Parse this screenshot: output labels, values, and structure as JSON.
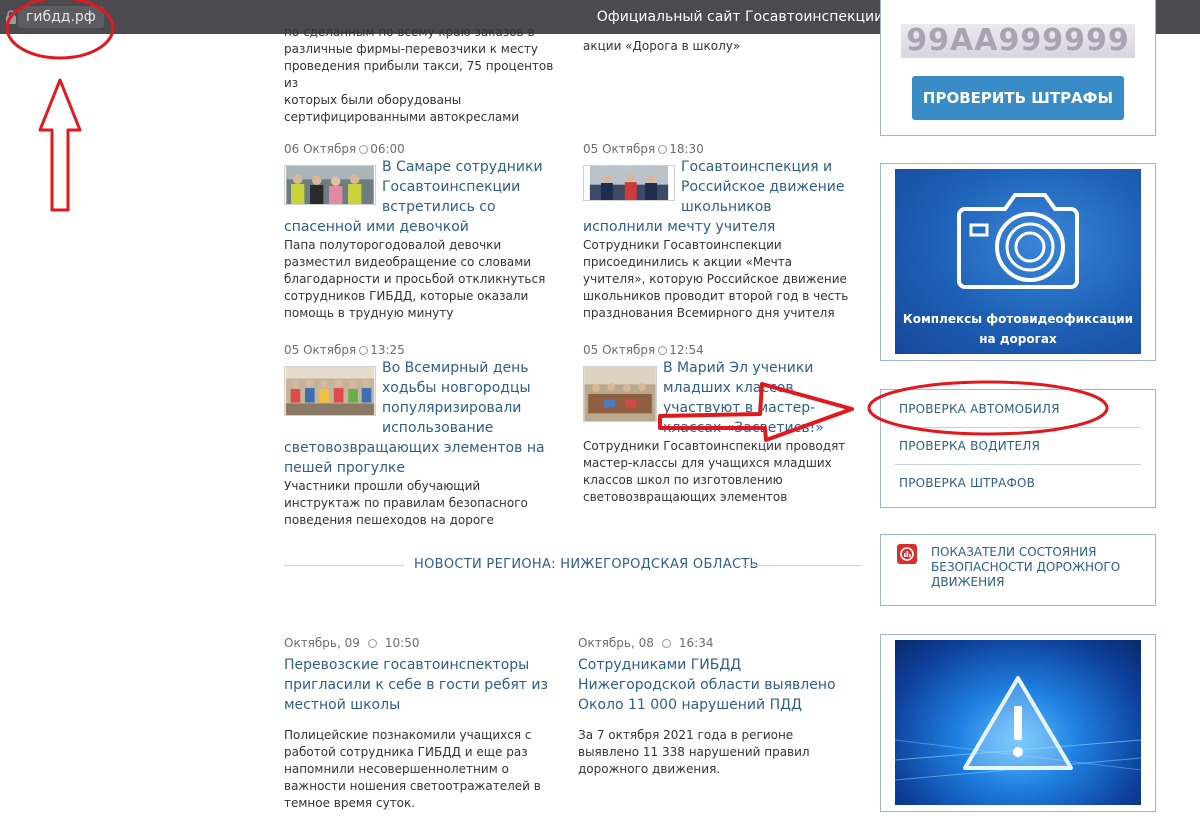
{
  "window": {
    "domain": "гибдд.рф",
    "title": "Официальный сайт Госавтоинспекции"
  },
  "top_fragments": {
    "left_lines": [
      "по сделанным по всему краю заказов в",
      "различные фирмы-перевозчики к месту",
      "проведения прибыли такси, 75 процентов из",
      "которых были оборудованы",
      "сертифицированными автокреслами"
    ],
    "right_line": "акции «Дорога в школу»"
  },
  "news": [
    {
      "date": "06 Октября",
      "time": "06:00",
      "title": "В Самаре сотрудники Госавтоинспекции встретились со спасенной ими девочкой",
      "text": "Папа полуторогодовалой девочки разместил видеобращение со словами благодарности и просьбой откликнуться сотрудников ГИБДД, которые оказали помощь в трудную минуту"
    },
    {
      "date": "05 Октября",
      "time": "18:30",
      "title": "Госавтоинспекция и Российское движение школьников исполнили мечту учителя",
      "text": "Сотрудники Госавтоинспекции присоединились к акции «Мечта учителя», которую Российское движение школьников проводит второй год в честь празднования Всемирного дня учителя"
    },
    {
      "date": "05 Октября",
      "time": "13:25",
      "title": "Во Всемирный день ходьбы новгородцы популяризировали использование световозвращающих элементов на пешей прогулке",
      "text": "Участники прошли обучающий инструктаж по правилам безопасного поведения пешеходов на дороге"
    },
    {
      "date": "05 Октября",
      "time": "12:54",
      "title": "В Марий Эл ученики младших классов участвуют в мастер-классах «Засветись!»",
      "text": "Сотрудники Госавтоинспекции проводят мастер-классы для учащихся младших классов школ по изготовлению световозвращающих элементов"
    }
  ],
  "region": {
    "heading": "НОВОСТИ РЕГИОНА: НИЖЕГОРОДСКАЯ ОБЛАСТЬ",
    "items": [
      {
        "date": "Октябрь, 09",
        "time": "10:50",
        "title": "Перевозские госавтоинспекторы пригласили к себе в гости ребят из местной школы",
        "text": "Полицейские познакомили учащихся с работой сотрудника ГИБДД и еще раз напомнили несовершеннолетним о важности ношения светоотражателей в темное время суток."
      },
      {
        "date": "Октябрь, 08",
        "time": "16:34",
        "title": "Сотрудниками ГИБДД Нижегородской области выявлено Около 11 000 нарушений ПДД",
        "text": "За 7 октября 2021 года в регионе выявлено 11 338 нарушений правил дорожного движения."
      }
    ]
  },
  "sidebar": {
    "plate_text": "99АА999999",
    "fines_button": "ПРОВЕРИТЬ ШТРАФЫ",
    "camera_banner": {
      "line1": "Комплексы фотовидеофиксации",
      "line2": "на дорогах"
    },
    "menu": [
      "ПРОВЕРКА АВТОМОБИЛЯ",
      "ПРОВЕРКА ВОДИТЕЛЯ",
      "ПРОВЕРКА ШТРАФОВ"
    ],
    "stats_link": "ПОКАЗАТЕЛИ СОСТОЯНИЯ БЕЗОПАСНОСТИ ДОРОЖНОГО ДВИЖЕНИЯ"
  },
  "colors": {
    "link": "#2e5e8a",
    "button": "#3a8cc7",
    "annotation": "#e0191e",
    "banner": "#1f5fb0"
  }
}
